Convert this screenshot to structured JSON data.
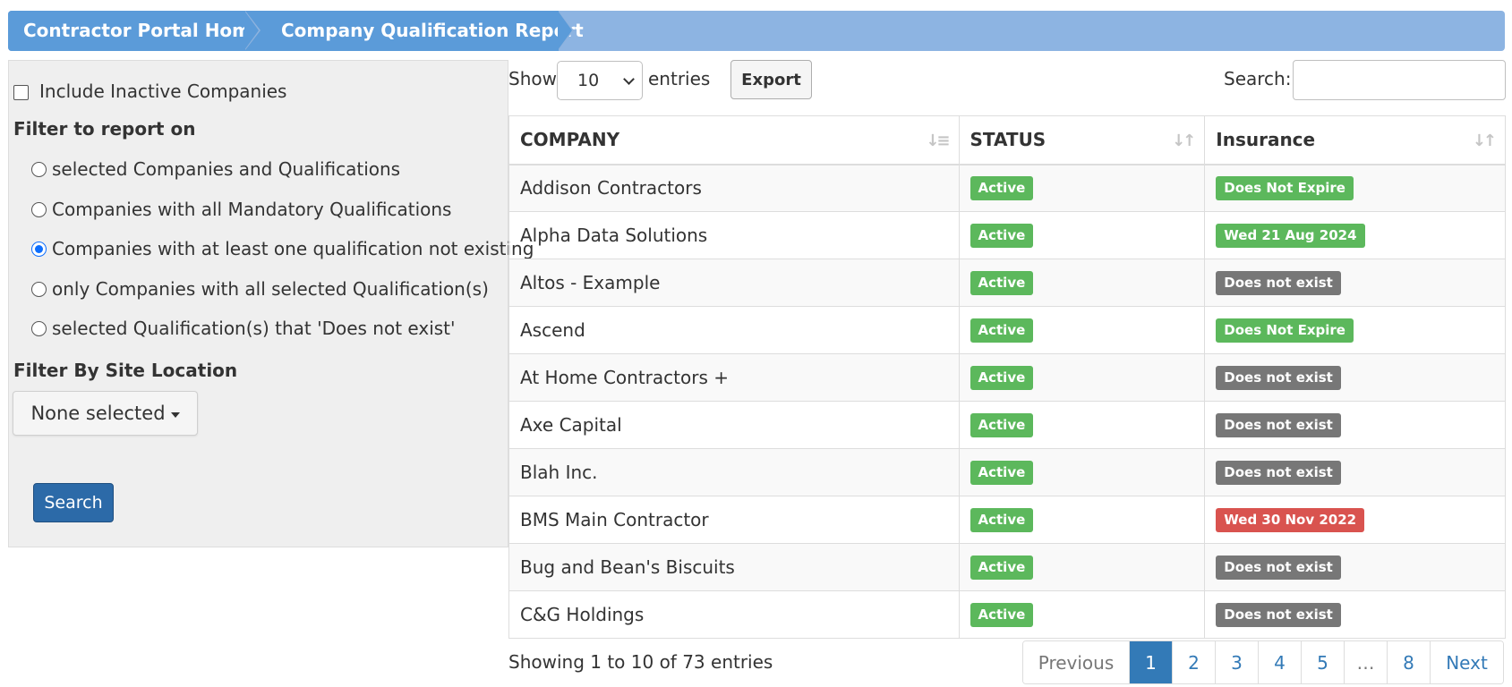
{
  "breadcrumb": {
    "items": [
      "Contractor Portal Home",
      "Company Qualification Report"
    ]
  },
  "filters": {
    "include_inactive_label": "Include Inactive Companies",
    "include_inactive_checked": false,
    "report_filter_title": "Filter to report on",
    "options": [
      {
        "label": "selected Companies and Qualifications",
        "selected": false
      },
      {
        "label": "Companies with all Mandatory Qualifications",
        "selected": false
      },
      {
        "label": "Companies with at least one qualification not existing",
        "selected": true
      },
      {
        "label": "only Companies with all selected Qualification(s)",
        "selected": false
      },
      {
        "label": "selected Qualification(s) that 'Does not exist'",
        "selected": false
      }
    ],
    "site_location_title": "Filter By Site Location",
    "site_location_value": "None selected",
    "search_button": "Search"
  },
  "table_controls": {
    "show_label": "Show",
    "entries_value": "10",
    "entries_label": "entries",
    "export_button": "Export",
    "search_label": "Search:",
    "search_value": ""
  },
  "table": {
    "columns": [
      "COMPANY",
      "STATUS",
      "Insurance"
    ],
    "rows": [
      {
        "company": "Addison Contractors",
        "status": "Active",
        "insurance": "Does Not Expire",
        "insurance_color": "#5cb85c"
      },
      {
        "company": "Alpha Data Solutions",
        "status": "Active",
        "insurance": "Wed 21 Aug 2024",
        "insurance_color": "#5cb85c"
      },
      {
        "company": "Altos - Example",
        "status": "Active",
        "insurance": "Does not exist",
        "insurance_color": "#777777"
      },
      {
        "company": "Ascend",
        "status": "Active",
        "insurance": "Does Not Expire",
        "insurance_color": "#5cb85c"
      },
      {
        "company": "At Home Contractors +",
        "status": "Active",
        "insurance": "Does not exist",
        "insurance_color": "#777777"
      },
      {
        "company": "Axe Capital",
        "status": "Active",
        "insurance": "Does not exist",
        "insurance_color": "#777777"
      },
      {
        "company": "Blah Inc.",
        "status": "Active",
        "insurance": "Does not exist",
        "insurance_color": "#777777"
      },
      {
        "company": "BMS Main Contractor",
        "status": "Active",
        "insurance": "Wed 30 Nov 2022",
        "insurance_color": "#d9534f"
      },
      {
        "company": "Bug and Bean's Biscuits",
        "status": "Active",
        "insurance": "Does not exist",
        "insurance_color": "#777777"
      },
      {
        "company": "C&G Holdings",
        "status": "Active",
        "insurance": "Does not exist",
        "insurance_color": "#777777"
      }
    ]
  },
  "footer": {
    "info": "Showing 1 to 10 of 73 entries",
    "pagination": {
      "previous": "Previous",
      "pages": [
        "1",
        "2",
        "3",
        "4",
        "5",
        "…",
        "8"
      ],
      "active_page": "1",
      "next": "Next"
    }
  },
  "colors": {
    "breadcrumb_active": "#5b9bd9",
    "breadcrumb_bar": "#8db4e2",
    "status_active": "#5cb85c",
    "primary_button": "#2c6aa8",
    "pagination_active": "#337ab7"
  }
}
